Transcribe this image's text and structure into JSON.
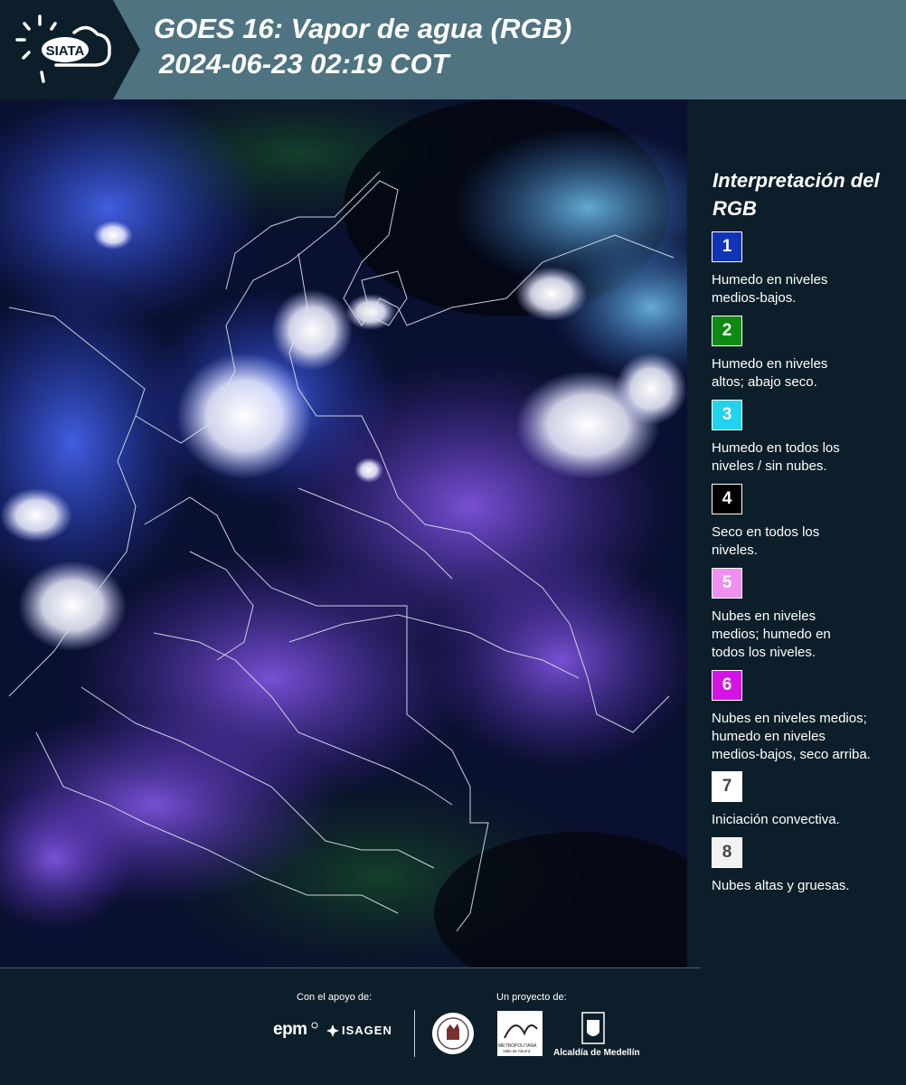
{
  "header": {
    "title_line1": "GOES 16: Vapor de agua (RGB)",
    "title_line2": " 2024-06-23 02:19 COT",
    "logo_text": "SIATA",
    "colors": {
      "band": "#4f7380",
      "logo_band": "#0c1e29"
    }
  },
  "map": {
    "description_icon": "satellite-water-vapor-rgb-map",
    "border_color": "#dce4ee"
  },
  "legend": {
    "title": "Interpretación del RGB",
    "items": [
      {
        "number": "1",
        "color": "#1033b8",
        "text_color": "#ffffff",
        "label": "Humedo en niveles\nmedios-bajos."
      },
      {
        "number": "2",
        "color": "#0e8a13",
        "text_color": "#ffffff",
        "label": "Humedo en niveles\naltos; abajo seco."
      },
      {
        "number": "3",
        "color": "#22d3ee",
        "text_color": "#ffffff",
        "label": "Humedo en todos los\nniveles / sin nubes."
      },
      {
        "number": "4",
        "color": "#000000",
        "text_color": "#ffffff",
        "label": "Seco en todos los\nniveles."
      },
      {
        "number": "5",
        "color": "#ef8ff0",
        "text_color": "#ffffff",
        "label": "Nubes en niveles\nmedios; humedo en\ntodos los niveles."
      },
      {
        "number": "6",
        "color": "#d414e3",
        "text_color": "#ffffff",
        "label": "Nubes en niveles medios;\nhumedo en niveles\nmedios-bajos, seco arriba."
      },
      {
        "number": "7",
        "color": "#ffffff",
        "text_color": "#444444",
        "label": "Iniciación convectiva."
      },
      {
        "number": "8",
        "color": "#f2f2f2",
        "text_color": "#444444",
        "label": "Nubes altas y gruesas."
      }
    ]
  },
  "footer": {
    "support_label": "Con el apoyo de:",
    "project_label": "Un proyecto de:",
    "epm_text": "epm",
    "isagen_text": "ISAGEN",
    "metro_text": "METROPOLITANA",
    "metro_sub": "Valle de Aburrá",
    "alcaldia_text": "Alcaldía de Medellín"
  }
}
